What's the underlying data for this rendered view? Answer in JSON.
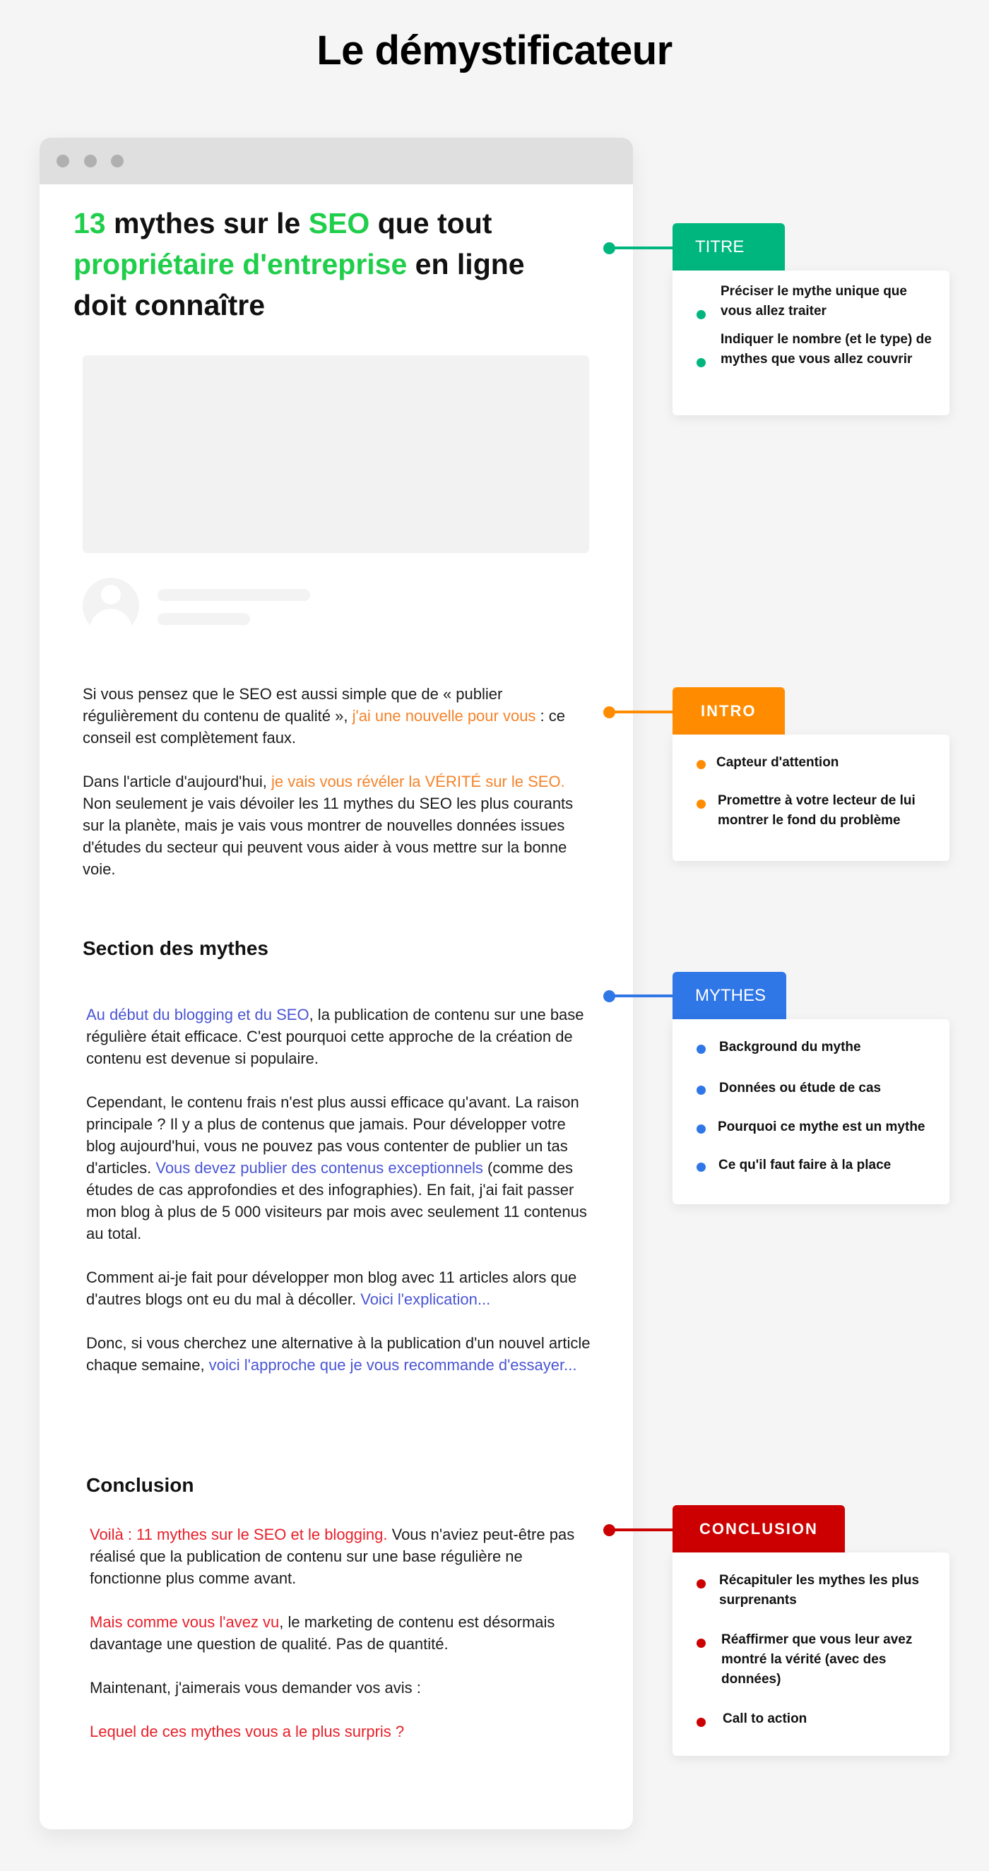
{
  "page": {
    "title": "Le démystificateur"
  },
  "article": {
    "title_parts": [
      {
        "text": "13",
        "hl": true
      },
      {
        "text": " mythes sur le ",
        "hl": false
      },
      {
        "text": "SEO",
        "hl": true
      },
      {
        "text": " que tout ",
        "hl": false
      },
      {
        "text": "propriétaire d'entreprise",
        "hl": true
      },
      {
        "text": " en ligne doit connaître",
        "hl": false
      }
    ],
    "intro": {
      "p1": [
        {
          "text": "Si vous pensez que le SEO est aussi simple que de « publier régulièrement du contenu de qualité », ",
          "hl": false
        },
        {
          "text": "j'ai une nouvelle pour vous",
          "hl": true
        },
        {
          "text": " : ce conseil est complètement faux.",
          "hl": false
        }
      ],
      "p2": [
        {
          "text": "Dans l'article d'aujourd'hui, ",
          "hl": false
        },
        {
          "text": "je vais vous révéler la VÉRITÉ sur le SEO.",
          "hl": true
        },
        {
          "text": " Non seulement je vais dévoiler les 11 mythes du SEO les plus courants sur la planète, mais je vais vous montrer de nouvelles données issues d'études du secteur qui peuvent vous aider à vous mettre sur la bonne voie.",
          "hl": false
        }
      ]
    },
    "myths_heading": "Section des mythes",
    "myths": {
      "p1": [
        {
          "text": "Au début du blogging et du SEO",
          "hl": true
        },
        {
          "text": ", la publication de contenu sur une base régulière était efficace. C'est pourquoi cette approche de la création de contenu est devenue si populaire.",
          "hl": false
        }
      ],
      "p2": [
        {
          "text": "Cependant, le contenu frais n'est plus aussi efficace qu'avant. La raison principale ? Il y a plus de contenus que jamais. Pour développer votre blog aujourd'hui, vous ne pouvez pas vous contenter de publier un tas d'articles. ",
          "hl": false
        },
        {
          "text": "Vous devez publier des contenus exceptionnels",
          "hl": true
        },
        {
          "text": " (comme des études de cas approfondies et des infographies). En fait, j'ai fait passer mon blog à plus de 5 000 visiteurs par mois avec seulement 11 contenus au total.",
          "hl": false
        }
      ],
      "p3": [
        {
          "text": "Comment ai-je fait pour développer mon blog avec 11 articles alors que d'autres blogs ont eu du mal à décoller. ",
          "hl": false
        },
        {
          "text": "Voici l'explication...",
          "hl": true
        }
      ],
      "p4": [
        {
          "text": "Donc, si vous cherchez une alternative à la publication d'un nouvel article chaque semaine, ",
          "hl": false
        },
        {
          "text": "voici l'approche que je vous recommande d'essayer...",
          "hl": true
        }
      ]
    },
    "conclusion_heading": "Conclusion",
    "conclusion": {
      "p1": [
        {
          "text": "Voilà : 11 mythes sur le SEO et le blogging.",
          "hl": true
        },
        {
          "text": " Vous n'aviez peut-être pas réalisé que la publication de contenu sur une base régulière ne fonctionne plus comme avant.",
          "hl": false
        }
      ],
      "p2": [
        {
          "text": "Mais comme vous l'avez vu",
          "hl": true
        },
        {
          "text": ", le marketing de contenu est désormais davantage une question de qualité. Pas de quantité.",
          "hl": false
        }
      ],
      "p3": [
        {
          "text": "Maintenant, j'aimerais vous demander vos avis :",
          "hl": false
        }
      ],
      "p4": [
        {
          "text": "Lequel de ces mythes vous a le plus surpris ?",
          "hl": true
        }
      ]
    }
  },
  "annotations": {
    "titre": {
      "label": "TITRE",
      "color": "#00b67f",
      "items": [
        "Préciser le mythe unique que vous allez traiter",
        "Indiquer le nombre (et le type) de mythes que vous allez couvrir"
      ]
    },
    "intro": {
      "label": "INTRO",
      "color": "#ff8c00",
      "items": [
        "Capteur d'attention",
        "Promettre à votre lecteur de lui montrer le fond du problème"
      ]
    },
    "mythes": {
      "label": "MYTHES",
      "color": "#2f76e6",
      "items": [
        "Background du mythe",
        "Données ou étude de cas",
        "Pourquoi ce mythe est un mythe",
        "Ce qu'il faut faire à la place"
      ]
    },
    "conclusion": {
      "label": "CONCLUSION",
      "color": "#cc0000",
      "items": [
        "Récapituler les mythes les plus surprenants",
        "Réaffirmer que vous leur avez montré la vérité (avec des données)",
        "Call to action"
      ]
    }
  },
  "colors": {
    "title_highlight": "#1fce4a",
    "intro_highlight": "#f5832a",
    "myths_highlight": "#4a55d4",
    "conclusion_highlight": "#e8202a"
  }
}
